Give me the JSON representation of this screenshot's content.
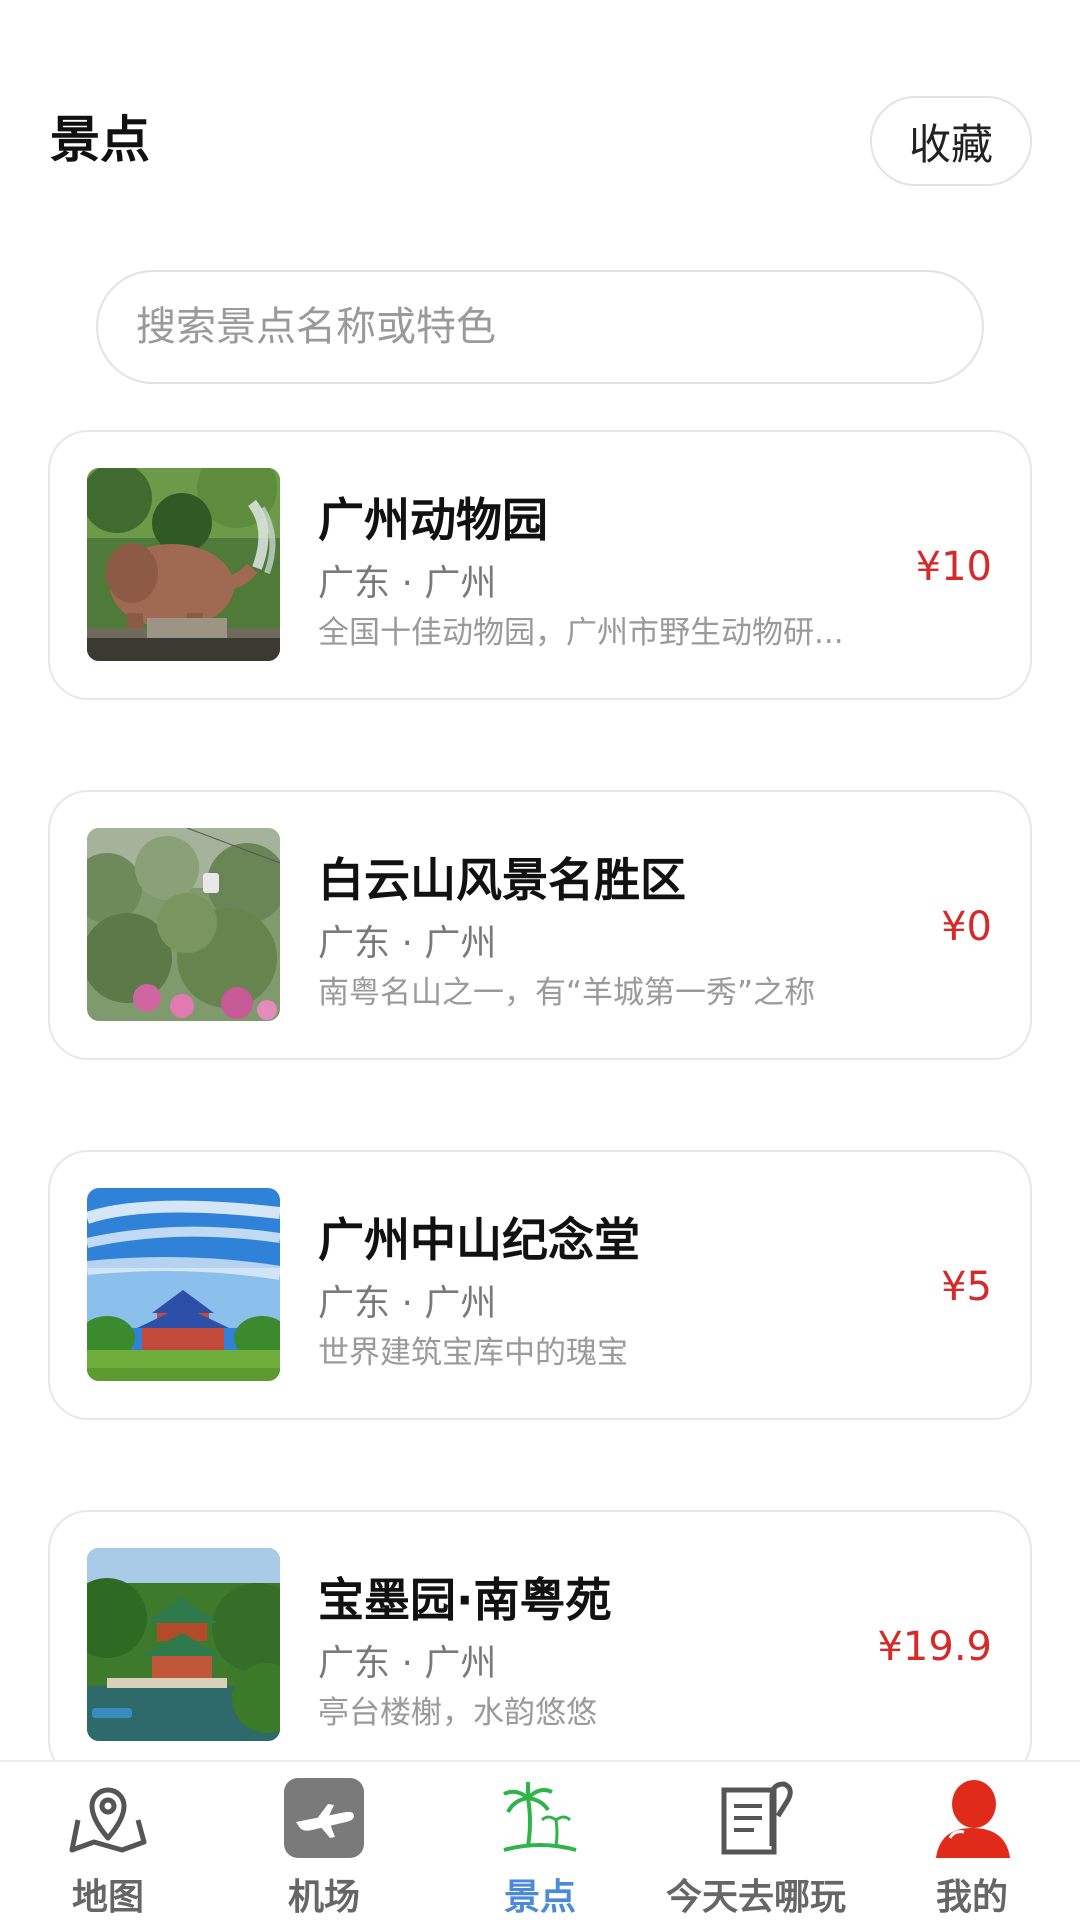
{
  "header": {
    "title": "景点",
    "favorite_label": "收藏"
  },
  "search": {
    "placeholder": "搜索景点名称或特色",
    "value": ""
  },
  "attractions": [
    {
      "name": "广州动物园",
      "location": "广东 · 广州",
      "description": "全国十佳动物园，广州市野生动物研...",
      "price": "¥10",
      "image": "elephant-photo"
    },
    {
      "name": "白云山风景名胜区",
      "location": "广东 · 广州",
      "description": "南粤名山之一，有“羊城第一秀”之称",
      "price": "¥0",
      "image": "mountain-cablecar-photo"
    },
    {
      "name": "广州中山纪念堂",
      "location": "广东 · 广州",
      "description": "世界建筑宝库中的瑰宝",
      "price": "¥5",
      "image": "memorial-hall-photo"
    },
    {
      "name": "宝墨园·南粤苑",
      "location": "广东 · 广州",
      "description": "亭台楼榭，水韵悠悠",
      "price": "¥19.9",
      "image": "garden-pavilion-photo"
    }
  ],
  "bottom_nav": {
    "items": [
      {
        "label": "地图",
        "icon": "map-pin-icon",
        "active": false
      },
      {
        "label": "机场",
        "icon": "airplane-icon",
        "active": false
      },
      {
        "label": "景点",
        "icon": "palm-tree-icon",
        "active": true
      },
      {
        "label": "今天去哪玩",
        "icon": "document-pen-icon",
        "active": false
      },
      {
        "label": "我的",
        "icon": "user-icon",
        "active": false
      }
    ]
  },
  "colors": {
    "price": "#d62a2a",
    "nav_active": "#4a8ad6",
    "nav_inactive": "#666666",
    "palm_green": "#2fb44a",
    "user_red": "#e02a1a"
  }
}
